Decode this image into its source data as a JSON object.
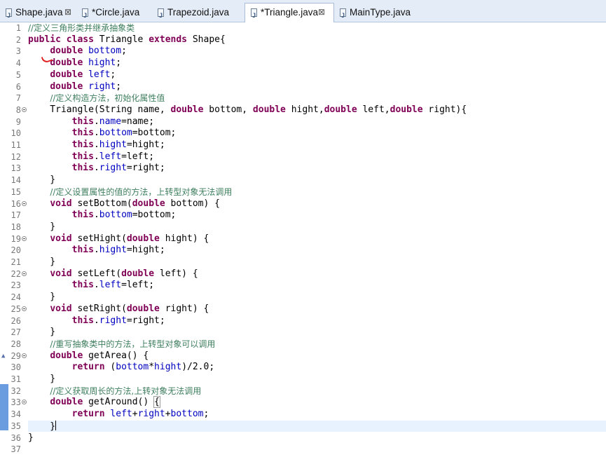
{
  "tabs": [
    {
      "label": "Shape.java",
      "close": "⊠",
      "active": false
    },
    {
      "label": "*Circle.java",
      "close": "",
      "active": false
    },
    {
      "label": "Trapezoid.java",
      "close": "",
      "active": false
    },
    {
      "label": "*Triangle.java",
      "close": "⊠",
      "active": true
    },
    {
      "label": "MainType.java",
      "close": "",
      "active": false
    }
  ],
  "editor": {
    "current_line": 35,
    "fold_lines": [
      8,
      16,
      19,
      22,
      25,
      29,
      33
    ],
    "override_lines": [
      29
    ],
    "changed_lines": [
      32,
      33,
      34,
      35
    ],
    "lines": [
      {
        "n": "1",
        "tokens": [
          [
            "cm",
            "//定义三角形类并继承抽象类"
          ]
        ]
      },
      {
        "n": "2",
        "tokens": [
          [
            "kw",
            "public"
          ],
          [
            "",
            " "
          ],
          [
            "kw",
            "class"
          ],
          [
            "",
            " Triangle "
          ],
          [
            "kw",
            "extends"
          ],
          [
            "",
            " Shape{"
          ]
        ]
      },
      {
        "n": "3",
        "tokens": [
          [
            "",
            "    "
          ],
          [
            "kw",
            "double"
          ],
          [
            "",
            " "
          ],
          [
            "fd",
            "bottom"
          ],
          [
            "",
            ";"
          ]
        ]
      },
      {
        "n": "4",
        "tokens": [
          [
            "",
            "    "
          ],
          [
            "kw",
            "double"
          ],
          [
            "",
            " "
          ],
          [
            "fd",
            "hight"
          ],
          [
            "",
            ";"
          ]
        ]
      },
      {
        "n": "5",
        "tokens": [
          [
            "",
            "    "
          ],
          [
            "kw",
            "double"
          ],
          [
            "",
            " "
          ],
          [
            "fd",
            "left"
          ],
          [
            "",
            ";"
          ]
        ]
      },
      {
        "n": "6",
        "tokens": [
          [
            "",
            "    "
          ],
          [
            "kw",
            "double"
          ],
          [
            "",
            " "
          ],
          [
            "fd",
            "right"
          ],
          [
            "",
            ";"
          ]
        ]
      },
      {
        "n": "7",
        "tokens": [
          [
            "",
            "    "
          ],
          [
            "cm",
            "//定义构造方法，初始化属性值"
          ]
        ]
      },
      {
        "n": "8",
        "tokens": [
          [
            "",
            "    Triangle(String name, "
          ],
          [
            "kw",
            "double"
          ],
          [
            "",
            " bottom, "
          ],
          [
            "kw",
            "double"
          ],
          [
            "",
            " hight,"
          ],
          [
            "kw",
            "double"
          ],
          [
            "",
            " left,"
          ],
          [
            "kw",
            "double"
          ],
          [
            "",
            " right){"
          ]
        ]
      },
      {
        "n": "9",
        "tokens": [
          [
            "",
            "        "
          ],
          [
            "kw",
            "this"
          ],
          [
            "",
            "."
          ],
          [
            "fd",
            "name"
          ],
          [
            "",
            "=name;"
          ]
        ]
      },
      {
        "n": "10",
        "tokens": [
          [
            "",
            "        "
          ],
          [
            "kw",
            "this"
          ],
          [
            "",
            "."
          ],
          [
            "fd",
            "bottom"
          ],
          [
            "",
            "=bottom;"
          ]
        ]
      },
      {
        "n": "11",
        "tokens": [
          [
            "",
            "        "
          ],
          [
            "kw",
            "this"
          ],
          [
            "",
            "."
          ],
          [
            "fd",
            "hight"
          ],
          [
            "",
            "=hight;"
          ]
        ]
      },
      {
        "n": "12",
        "tokens": [
          [
            "",
            "        "
          ],
          [
            "kw",
            "this"
          ],
          [
            "",
            "."
          ],
          [
            "fd",
            "left"
          ],
          [
            "",
            "=left;"
          ]
        ]
      },
      {
        "n": "13",
        "tokens": [
          [
            "",
            "        "
          ],
          [
            "kw",
            "this"
          ],
          [
            "",
            "."
          ],
          [
            "fd",
            "right"
          ],
          [
            "",
            "=right;"
          ]
        ]
      },
      {
        "n": "14",
        "tokens": [
          [
            "",
            "    }"
          ]
        ]
      },
      {
        "n": "15",
        "tokens": [
          [
            "",
            "    "
          ],
          [
            "cm",
            "//定义设置属性的值的方法，上转型对象无法调用"
          ]
        ]
      },
      {
        "n": "16",
        "tokens": [
          [
            "",
            "    "
          ],
          [
            "kw",
            "void"
          ],
          [
            "",
            " setBottom("
          ],
          [
            "kw",
            "double"
          ],
          [
            "",
            " bottom) {"
          ]
        ]
      },
      {
        "n": "17",
        "tokens": [
          [
            "",
            "        "
          ],
          [
            "kw",
            "this"
          ],
          [
            "",
            "."
          ],
          [
            "fd",
            "bottom"
          ],
          [
            "",
            "=bottom;"
          ]
        ]
      },
      {
        "n": "18",
        "tokens": [
          [
            "",
            "    }"
          ]
        ]
      },
      {
        "n": "19",
        "tokens": [
          [
            "",
            "    "
          ],
          [
            "kw",
            "void"
          ],
          [
            "",
            " setHight("
          ],
          [
            "kw",
            "double"
          ],
          [
            "",
            " hight) {"
          ]
        ]
      },
      {
        "n": "20",
        "tokens": [
          [
            "",
            "        "
          ],
          [
            "kw",
            "this"
          ],
          [
            "",
            "."
          ],
          [
            "fd",
            "hight"
          ],
          [
            "",
            "=hight;"
          ]
        ]
      },
      {
        "n": "21",
        "tokens": [
          [
            "",
            "    }"
          ]
        ]
      },
      {
        "n": "22",
        "tokens": [
          [
            "",
            "    "
          ],
          [
            "kw",
            "void"
          ],
          [
            "",
            " setLeft("
          ],
          [
            "kw",
            "double"
          ],
          [
            "",
            " left) {"
          ]
        ]
      },
      {
        "n": "23",
        "tokens": [
          [
            "",
            "        "
          ],
          [
            "kw",
            "this"
          ],
          [
            "",
            "."
          ],
          [
            "fd",
            "left"
          ],
          [
            "",
            "=left;"
          ]
        ]
      },
      {
        "n": "24",
        "tokens": [
          [
            "",
            "    }"
          ]
        ]
      },
      {
        "n": "25",
        "tokens": [
          [
            "",
            "    "
          ],
          [
            "kw",
            "void"
          ],
          [
            "",
            " setRight("
          ],
          [
            "kw",
            "double"
          ],
          [
            "",
            " right) {"
          ]
        ]
      },
      {
        "n": "26",
        "tokens": [
          [
            "",
            "        "
          ],
          [
            "kw",
            "this"
          ],
          [
            "",
            "."
          ],
          [
            "fd",
            "right"
          ],
          [
            "",
            "=right;"
          ]
        ]
      },
      {
        "n": "27",
        "tokens": [
          [
            "",
            "    }"
          ]
        ]
      },
      {
        "n": "28",
        "tokens": [
          [
            "",
            "    "
          ],
          [
            "cm",
            "//重写抽象类中的方法，上转型对象可以调用"
          ]
        ]
      },
      {
        "n": "29",
        "tokens": [
          [
            "",
            "    "
          ],
          [
            "kw",
            "double"
          ],
          [
            "",
            " getArea() {"
          ]
        ]
      },
      {
        "n": "30",
        "tokens": [
          [
            "",
            "        "
          ],
          [
            "kw",
            "return"
          ],
          [
            "",
            " ("
          ],
          [
            "fd",
            "bottom"
          ],
          [
            "",
            "*"
          ],
          [
            "fd",
            "hight"
          ],
          [
            "",
            ")/2.0;"
          ]
        ]
      },
      {
        "n": "31",
        "tokens": [
          [
            "",
            "    }"
          ]
        ]
      },
      {
        "n": "32",
        "tokens": [
          [
            "",
            "    "
          ],
          [
            "cm",
            "//定义获取周长的方法,上转对象无法调用"
          ]
        ]
      },
      {
        "n": "33",
        "tokens": [
          [
            "",
            "    "
          ],
          [
            "kw",
            "double"
          ],
          [
            "",
            " getAround() "
          ],
          [
            "bracebox",
            "{"
          ]
        ]
      },
      {
        "n": "34",
        "tokens": [
          [
            "",
            "        "
          ],
          [
            "kw",
            "return"
          ],
          [
            "",
            " "
          ],
          [
            "fd",
            "left"
          ],
          [
            "",
            "+"
          ],
          [
            "fd",
            "right"
          ],
          [
            "",
            "+"
          ],
          [
            "fd",
            "bottom"
          ],
          [
            "",
            ";"
          ]
        ]
      },
      {
        "n": "35",
        "tokens": [
          [
            "",
            "    }"
          ],
          [
            "cursor",
            ""
          ]
        ]
      },
      {
        "n": "36",
        "tokens": [
          [
            "",
            "}"
          ]
        ]
      },
      {
        "n": "37",
        "tokens": []
      }
    ]
  }
}
